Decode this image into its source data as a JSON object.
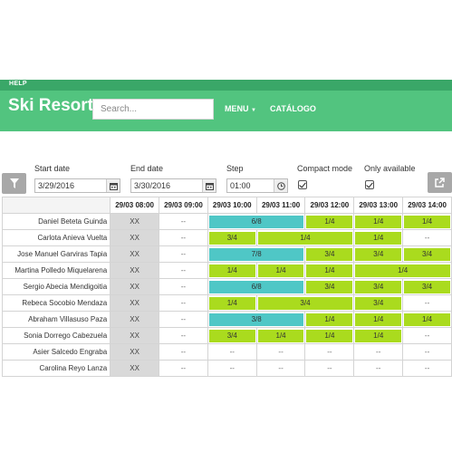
{
  "header": {
    "help": "HELP",
    "brand": "Ski Resort",
    "search_placeholder": "Search...",
    "menu": "MENU",
    "catalog": "CATÁLOGO"
  },
  "filters": {
    "start_label": "Start date",
    "start_value": "3/29/2016",
    "end_label": "End date",
    "end_value": "3/30/2016",
    "step_label": "Step",
    "step_value": "01:00",
    "compact_label": "Compact mode",
    "compact_checked": true,
    "only_label": "Only available",
    "only_checked": true
  },
  "colors": {
    "nav": "#52c47f",
    "lime": "#aadb1e",
    "cyan": "#4fc7c6",
    "fixed": "#d9d9d9"
  },
  "grid": {
    "columns": [
      "29/03 08:00",
      "29/03 09:00",
      "29/03 10:00",
      "29/03 11:00",
      "29/03 12:00",
      "29/03 13:00",
      "29/03 14:00"
    ],
    "rows": [
      {
        "name": "Daniel Beteta Guinda",
        "cells": [
          {
            "text": "XX",
            "type": "fixed"
          },
          {
            "text": "--",
            "type": "empty"
          },
          {
            "text": "6/8",
            "type": "cyan",
            "span": 2
          },
          {
            "text": "1/4",
            "type": "lime"
          },
          {
            "text": "1/4",
            "type": "lime"
          },
          {
            "text": "1/4",
            "type": "lime"
          }
        ]
      },
      {
        "name": "Carlota Anieva Vuelta",
        "cells": [
          {
            "text": "XX",
            "type": "fixed"
          },
          {
            "text": "--",
            "type": "empty"
          },
          {
            "text": "3/4",
            "type": "lime"
          },
          {
            "text": "1/4",
            "type": "lime",
            "span": 2
          },
          {
            "text": "1/4",
            "type": "lime"
          },
          {
            "text": "--",
            "type": "empty"
          }
        ]
      },
      {
        "name": "Jose Manuel Garviras Tapia",
        "cells": [
          {
            "text": "XX",
            "type": "fixed"
          },
          {
            "text": "--",
            "type": "empty"
          },
          {
            "text": "7/8",
            "type": "cyan",
            "span": 2
          },
          {
            "text": "3/4",
            "type": "lime"
          },
          {
            "text": "3/4",
            "type": "lime"
          },
          {
            "text": "3/4",
            "type": "lime"
          }
        ]
      },
      {
        "name": "Martina Polledo Miquelarena",
        "cells": [
          {
            "text": "XX",
            "type": "fixed"
          },
          {
            "text": "--",
            "type": "empty"
          },
          {
            "text": "1/4",
            "type": "lime"
          },
          {
            "text": "1/4",
            "type": "lime"
          },
          {
            "text": "1/4",
            "type": "lime"
          },
          {
            "text": "1/4",
            "type": "lime",
            "span": 2
          }
        ]
      },
      {
        "name": "Sergio Abecia Mendigoitia",
        "cells": [
          {
            "text": "XX",
            "type": "fixed"
          },
          {
            "text": "--",
            "type": "empty"
          },
          {
            "text": "6/8",
            "type": "cyan",
            "span": 2
          },
          {
            "text": "3/4",
            "type": "lime"
          },
          {
            "text": "3/4",
            "type": "lime"
          },
          {
            "text": "3/4",
            "type": "lime"
          }
        ]
      },
      {
        "name": "Rebeca Socobio Mendaza",
        "cells": [
          {
            "text": "XX",
            "type": "fixed"
          },
          {
            "text": "--",
            "type": "empty"
          },
          {
            "text": "1/4",
            "type": "lime"
          },
          {
            "text": "3/4",
            "type": "lime",
            "span": 2
          },
          {
            "text": "3/4",
            "type": "lime"
          },
          {
            "text": "--",
            "type": "empty"
          }
        ]
      },
      {
        "name": "Abraham Villasuso Paza",
        "cells": [
          {
            "text": "XX",
            "type": "fixed"
          },
          {
            "text": "--",
            "type": "empty"
          },
          {
            "text": "3/8",
            "type": "cyan",
            "span": 2
          },
          {
            "text": "1/4",
            "type": "lime"
          },
          {
            "text": "1/4",
            "type": "lime"
          },
          {
            "text": "1/4",
            "type": "lime"
          }
        ]
      },
      {
        "name": "Sonia Dorrego Cabezuela",
        "cells": [
          {
            "text": "XX",
            "type": "fixed"
          },
          {
            "text": "--",
            "type": "empty"
          },
          {
            "text": "3/4",
            "type": "lime"
          },
          {
            "text": "1/4",
            "type": "lime"
          },
          {
            "text": "1/4",
            "type": "lime"
          },
          {
            "text": "1/4",
            "type": "lime"
          },
          {
            "text": "--",
            "type": "empty"
          }
        ]
      },
      {
        "name": "Asier Salcedo Engraba",
        "cells": [
          {
            "text": "XX",
            "type": "fixed"
          },
          {
            "text": "--",
            "type": "empty"
          },
          {
            "text": "--",
            "type": "empty"
          },
          {
            "text": "--",
            "type": "empty"
          },
          {
            "text": "--",
            "type": "empty"
          },
          {
            "text": "--",
            "type": "empty"
          },
          {
            "text": "--",
            "type": "empty"
          }
        ]
      },
      {
        "name": "Carolina Reyo Lanza",
        "cells": [
          {
            "text": "XX",
            "type": "fixed"
          },
          {
            "text": "--",
            "type": "empty"
          },
          {
            "text": "--",
            "type": "empty"
          },
          {
            "text": "--",
            "type": "empty"
          },
          {
            "text": "--",
            "type": "empty"
          },
          {
            "text": "--",
            "type": "empty"
          },
          {
            "text": "--",
            "type": "empty"
          }
        ]
      }
    ]
  }
}
